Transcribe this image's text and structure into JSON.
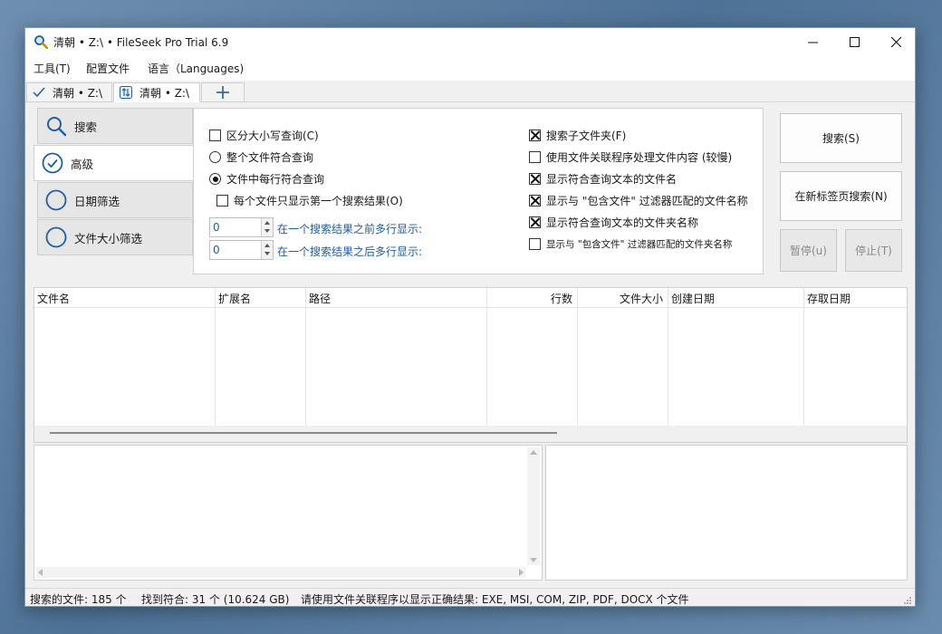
{
  "window": {
    "title": "清朝 • Z:\\ • FileSeek Pro Trial 6.9"
  },
  "menu": [
    "工具(T)",
    "配置文件",
    "语言（Languages)"
  ],
  "doc_tabs": [
    {
      "label": "清朝 • Z:\\",
      "icon": "check-icon"
    },
    {
      "label": "清朝 • Z:\\",
      "icon": "sync-icon",
      "active": true
    }
  ],
  "side_tabs": [
    {
      "label": "搜索",
      "icon": "search-icon"
    },
    {
      "label": "高级",
      "icon": "check-circle-icon",
      "active": true
    },
    {
      "label": "日期筛选",
      "icon": "circle-icon"
    },
    {
      "label": "文件大小筛选",
      "icon": "circle-icon"
    }
  ],
  "options": {
    "case_sensitive": {
      "label": "区分大小写查询(C)",
      "checked": false
    },
    "whole_file": {
      "label": "整个文件符合查询",
      "selected": false
    },
    "each_line": {
      "label": "文件中每行符合查询",
      "selected": true
    },
    "first_result_only": {
      "label": "每个文件只显示第一个搜索结果(O)",
      "checked": false
    },
    "lines_before": {
      "value": "0",
      "label": "在一个搜索结果之前多行显示:"
    },
    "lines_after": {
      "value": "0",
      "label": "在一个搜索结果之后多行显示:"
    },
    "search_subfolders": {
      "label": "搜索子文件夹(F)",
      "checked": true
    },
    "use_associations": {
      "label": "使用文件关联程序处理文件内容 (较慢)",
      "checked": false
    },
    "show_matching_filenames": {
      "label": "显示符合查询文本的文件名",
      "checked": true
    },
    "show_include_filter_files": {
      "label": "显示与 \"包含文件\" 过滤器匹配的文件名称",
      "checked": true
    },
    "show_matching_folders": {
      "label": "显示符合查询文本的文件夹名称",
      "checked": true
    },
    "show_include_filter_folders": {
      "label": "显示与 \"包含文件\" 过滤器匹配的文件夹名称",
      "checked": false
    }
  },
  "buttons": {
    "search": "搜索(S)",
    "search_new_tab": "在新标签页搜索(N)",
    "pause": "暂停(u)",
    "stop": "停止(T)"
  },
  "columns": [
    "文件名",
    "扩展名",
    "路径",
    "行数",
    "文件大小",
    "创建日期",
    "存取日期"
  ],
  "status": {
    "files_searched": "搜索的文件: 185 个",
    "matches_found": "找到符合: 31 个 (10.624 GB)",
    "hint": "请使用文件关联程序以显示正确结果: EXE, MSI, COM, ZIP, PDF, DOCX 个文件"
  },
  "colors": {
    "accent": "#1f5fa0",
    "background": "#f0f0f0"
  }
}
